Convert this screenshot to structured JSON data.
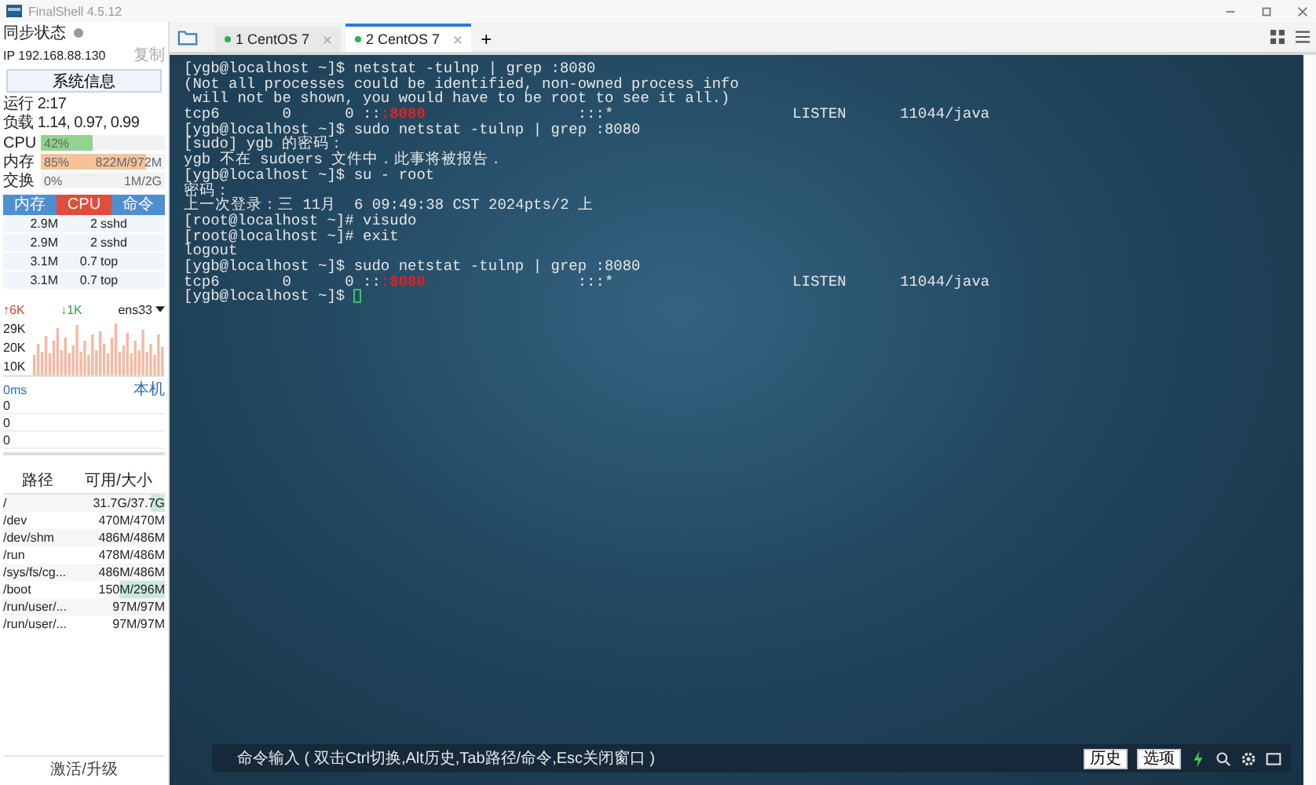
{
  "window": {
    "title": "FinalShell 4.5.12"
  },
  "sidebar": {
    "sync_label": "同步状态",
    "ip": "IP  192.168.88.130",
    "copy_link": "复制",
    "sysinfo_button": "系统信息",
    "uptime": "运行 2:17",
    "load": "负载 1.14, 0.97, 0.99",
    "meters": [
      {
        "label": "CPU",
        "value": "42%",
        "level": 0.42,
        "color": "#92d38f"
      },
      {
        "label": "内存",
        "value": "85%",
        "detail": "822M/972M",
        "level": 0.85,
        "color": "#f5c29a"
      },
      {
        "label": "交换",
        "value": "0%",
        "detail": "1M/2G"
      }
    ],
    "process_columns": [
      {
        "label": "内存",
        "selected": false
      },
      {
        "label": "CPU",
        "selected": true
      },
      {
        "label": "命令",
        "selected": false
      }
    ],
    "process_rows": [
      [
        "2.9M",
        "2",
        "sshd"
      ],
      [
        "2.9M",
        "2",
        "sshd"
      ],
      [
        "3.1M",
        "0.7",
        "top"
      ],
      [
        "3.1M",
        "0.7",
        "top"
      ]
    ],
    "network": {
      "up": "↑6K",
      "down": "↓1K",
      "interface": "ens33",
      "ticks": [
        "29K",
        "20K",
        "10K"
      ]
    },
    "ping": {
      "latency": "0ms",
      "host": "本机",
      "ticks": [
        "0",
        "0",
        "0"
      ]
    },
    "disk_columns": [
      "路径",
      "可用/大小"
    ],
    "disks": [
      {
        "path": "/",
        "usage": "31.7G/37.7G",
        "level": 0.16
      },
      {
        "path": "/dev",
        "usage": "470M/470M"
      },
      {
        "path": "/dev/shm",
        "usage": "486M/486M"
      },
      {
        "path": "/run",
        "usage": "478M/486M"
      },
      {
        "path": "/sys/fs/cg...",
        "usage": "486M/486M"
      },
      {
        "path": "/boot",
        "usage": "150M/296M",
        "level": 0.49
      },
      {
        "path": "/run/user/...",
        "usage": "97M/97M"
      },
      {
        "path": "/run/user/...",
        "usage": "97M/97M"
      }
    ],
    "footer_link": "激活/升级"
  },
  "tabs": [
    {
      "label": "1 CentOS 7",
      "selected": false
    },
    {
      "label": "2 CentOS 7",
      "selected": true
    }
  ],
  "add_tab": "+",
  "terminal": {
    "cursor_visible": true,
    "lines": [
      {
        "segments": [
          {
            "text": "[ygb@localhost ~]$ netstat -tulnp | grep :8080",
            "highlight": false
          }
        ]
      },
      {
        "segments": [
          {
            "text": "(Not all processes could be identified, non-owned process info",
            "highlight": false
          }
        ]
      },
      {
        "segments": [
          {
            "text": " will not be shown, you would have to be root to see it all.)",
            "highlight": false
          }
        ]
      },
      {
        "segments": [
          {
            "text": "tcp6       0      0 ::",
            "highlight": false
          },
          {
            "text": ":8080",
            "highlight": true
          },
          {
            "text": "                 :::*                    LISTEN      11044/java",
            "highlight": false
          }
        ]
      },
      {
        "segments": [
          {
            "text": "[ygb@localhost ~]$ sudo netstat -tulnp | grep :8080",
            "highlight": false
          }
        ]
      },
      {
        "segments": [
          {
            "text": "[sudo] ygb 的密码：",
            "highlight": false
          }
        ]
      },
      {
        "segments": [
          {
            "text": "ygb 不在 sudoers 文件中．此事将被报告．",
            "highlight": false
          }
        ]
      },
      {
        "segments": [
          {
            "text": "[ygb@localhost ~]$ su - root",
            "highlight": false
          }
        ]
      },
      {
        "segments": [
          {
            "text": "密码：",
            "highlight": false
          }
        ]
      },
      {
        "segments": [
          {
            "text": "上一次登录：三 11月  6 09:49:38 CST 2024pts/2 上",
            "highlight": false
          }
        ]
      },
      {
        "segments": [
          {
            "text": "[root@localhost ~]# visudo",
            "highlight": false
          }
        ]
      },
      {
        "segments": [
          {
            "text": "[root@localhost ~]# exit",
            "highlight": false
          }
        ]
      },
      {
        "segments": [
          {
            "text": "logout",
            "highlight": false
          }
        ]
      },
      {
        "segments": [
          {
            "text": "[ygb@localhost ~]$ sudo netstat -tulnp | grep :8080",
            "highlight": false
          }
        ]
      },
      {
        "segments": [
          {
            "text": "tcp6       0      0 ::",
            "highlight": false
          },
          {
            "text": ":8080",
            "highlight": true
          },
          {
            "text": "                 :::*                    LISTEN      11044/java",
            "highlight": false
          }
        ]
      },
      {
        "segments": [
          {
            "text": "[ygb@localhost ~]$ ",
            "highlight": false
          }
        ]
      }
    ]
  },
  "command_bar": {
    "hint": "命令输入 ( 双击Ctrl切换,Alt历史,Tab路径/命令,Esc关闭窗口 )",
    "buttons": [
      "历史",
      "选项"
    ]
  }
}
